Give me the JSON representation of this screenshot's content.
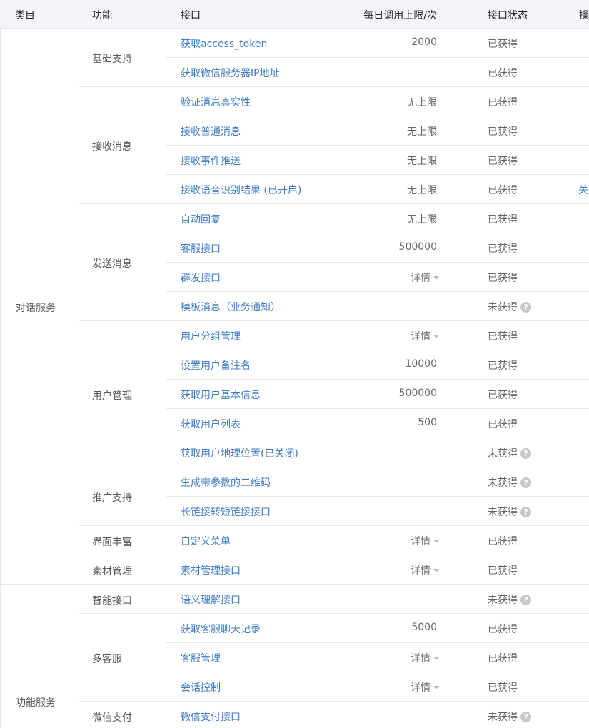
{
  "headers": {
    "category": "类目",
    "function": "功能",
    "api": "接口",
    "limit": "每日调用上限/次",
    "status": "接口状态",
    "operation": "操"
  },
  "categories": [
    "对话服务",
    "功能服务"
  ],
  "functions": [
    "基础支持",
    "接收消息",
    "发送消息",
    "用户管理",
    "推广支持",
    "界面丰富",
    "素材管理",
    "智能接口",
    "多客服",
    "微信支付"
  ],
  "detail_label": "详情",
  "rows": [
    {
      "api": "获取access_token",
      "limit": "2000",
      "status": "已获得"
    },
    {
      "api": "获取微信服务器IP地址",
      "limit": "",
      "status": "已获得"
    },
    {
      "api": "验证消息真实性",
      "limit": "无上限",
      "status": "已获得"
    },
    {
      "api": "接收普通消息",
      "limit": "无上限",
      "status": "已获得"
    },
    {
      "api": "接收事件推送",
      "limit": "无上限",
      "status": "已获得"
    },
    {
      "api": "接收语音识别结果 (已开启)",
      "limit": "无上限",
      "status": "已获得",
      "op": "关"
    },
    {
      "api": "自动回复",
      "limit": "无上限",
      "status": "已获得"
    },
    {
      "api": "客服接口",
      "limit": "500000",
      "status": "已获得"
    },
    {
      "api": "群发接口",
      "limit": "详情",
      "status": "已获得"
    },
    {
      "api": "模板消息（业务通知）",
      "limit": "",
      "status": "未获得"
    },
    {
      "api": "用户分组管理",
      "limit": "详情",
      "status": "已获得"
    },
    {
      "api": "设置用户备注名",
      "limit": "10000",
      "status": "已获得"
    },
    {
      "api": "获取用户基本信息",
      "limit": "500000",
      "status": "已获得"
    },
    {
      "api": "获取用户列表",
      "limit": "500",
      "status": "已获得"
    },
    {
      "api": "获取用户地理位置(已关闭)",
      "limit": "",
      "status": "未获得"
    },
    {
      "api": "生成带参数的二维码",
      "limit": "",
      "status": "未获得"
    },
    {
      "api": "长链接转短链接接口",
      "limit": "",
      "status": "未获得"
    },
    {
      "api": "自定义菜单",
      "limit": "详情",
      "status": "已获得"
    },
    {
      "api": "素材管理接口",
      "limit": "详情",
      "status": "已获得"
    },
    {
      "api": "语义理解接口",
      "limit": "",
      "status": "未获得"
    },
    {
      "api": "获取客服聊天记录",
      "limit": "5000",
      "status": "已获得"
    },
    {
      "api": "客服管理",
      "limit": "详情",
      "status": "已获得"
    },
    {
      "api": "会话控制",
      "limit": "详情",
      "status": "已获得"
    },
    {
      "api": "微信支付接口",
      "limit": "",
      "status": "未获得"
    }
  ],
  "colors": {
    "link": "#3e7bc5",
    "header_bg": "#f4f5f9",
    "border": "#e4e8eb"
  }
}
